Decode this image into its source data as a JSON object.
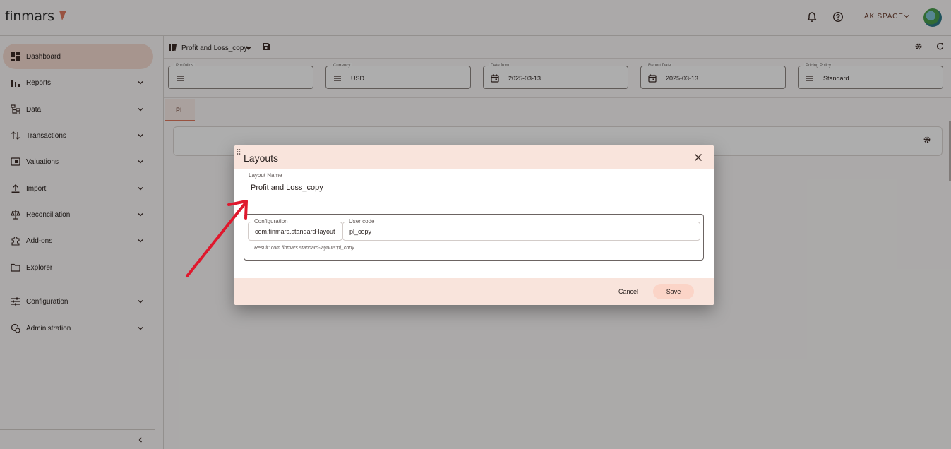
{
  "app": {
    "logo_text": "finmars",
    "workspace": "AK SPACE"
  },
  "topbar": {
    "icons": [
      "bell-icon",
      "help-icon"
    ]
  },
  "sidebar": {
    "items": [
      {
        "label": "Dashboard",
        "icon": "dashboard-icon",
        "active": true,
        "expandable": false
      },
      {
        "label": "Reports",
        "icon": "reports-icon",
        "expandable": true
      },
      {
        "label": "Data",
        "icon": "data-icon",
        "expandable": true
      },
      {
        "label": "Transactions",
        "icon": "transactions-icon",
        "expandable": true
      },
      {
        "label": "Valuations",
        "icon": "valuations-icon",
        "expandable": true
      },
      {
        "label": "Import",
        "icon": "import-icon",
        "expandable": true
      },
      {
        "label": "Reconciliation",
        "icon": "reconciliation-icon",
        "expandable": true
      },
      {
        "label": "Add-ons",
        "icon": "addons-icon",
        "expandable": true
      },
      {
        "label": "Explorer",
        "icon": "explorer-icon",
        "expandable": false
      },
      {
        "label": "Configuration",
        "icon": "configuration-icon",
        "expandable": true
      },
      {
        "label": "Administration",
        "icon": "administration-icon",
        "expandable": true
      }
    ]
  },
  "toolbar": {
    "layout_name": "Profit and Loss_copy"
  },
  "filters": [
    {
      "label": "Portfolios",
      "value": "",
      "icon": "list-icon"
    },
    {
      "label": "Currency",
      "value": "USD",
      "icon": "list-icon"
    },
    {
      "label": "Date from",
      "value": "2025-03-13",
      "icon": "calendar-icon"
    },
    {
      "label": "Report Date",
      "value": "2025-03-13",
      "icon": "calendar-icon"
    },
    {
      "label": "Pricing Policy",
      "value": "Standard",
      "icon": "list-icon"
    }
  ],
  "tabs": [
    {
      "label": "PL"
    }
  ],
  "dialog": {
    "title": "Layouts",
    "layout_name_label": "Layout Name",
    "layout_name_value": "Profit and Loss_copy",
    "configuration_label": "Configuration",
    "configuration_value": "com.finmars.standard-layout",
    "user_code_label": "User code",
    "user_code_value": "pl_copy",
    "result_text": "Result: com.finmars.standard-layouts:pl_copy",
    "cancel_label": "Cancel",
    "save_label": "Save"
  },
  "colors": {
    "accent": "#e07a5f",
    "active_nav": "#f7dcd2",
    "dialog_band": "#f9e4dc",
    "annotation_arrow": "#e0182d"
  }
}
